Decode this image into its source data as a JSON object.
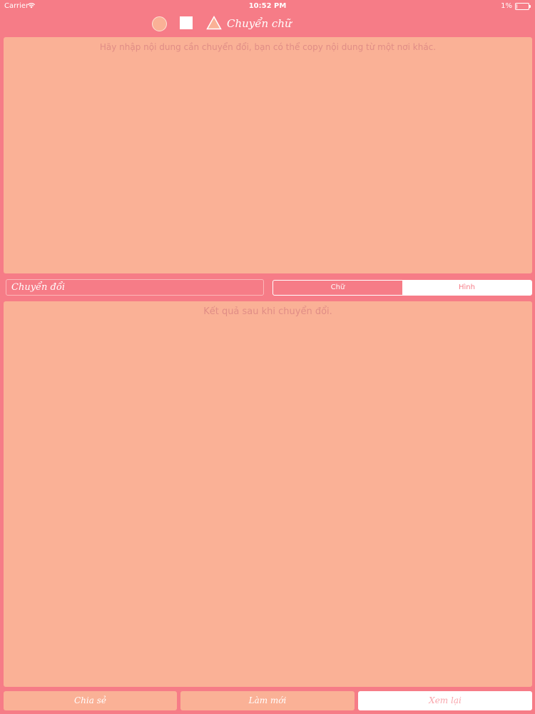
{
  "status_bar": {
    "carrier": "Carrier",
    "time": "10:52 PM",
    "battery": "1%"
  },
  "nav": {
    "title": "Chuyển chữ",
    "icons": [
      "circle-icon",
      "square-icon",
      "triangle-icon"
    ]
  },
  "input": {
    "placeholder": "Hãy nhập nội dung cần chuyển đổi, bạn có thể copy nội dung từ một nơi khác."
  },
  "convert_button": {
    "label": "Chuyển đổi"
  },
  "segmented": {
    "options": [
      "Chữ",
      "Hình"
    ],
    "selected": "Hình"
  },
  "result": {
    "placeholder": "Kết quả sau khi chuyển đổi."
  },
  "bottom_buttons": {
    "save": "Chia sẻ",
    "new": "Làm mới",
    "review": "Xem lại"
  },
  "colors": {
    "background": "#F67C87",
    "panel": "#FAB196",
    "white": "#FFFFFF"
  }
}
